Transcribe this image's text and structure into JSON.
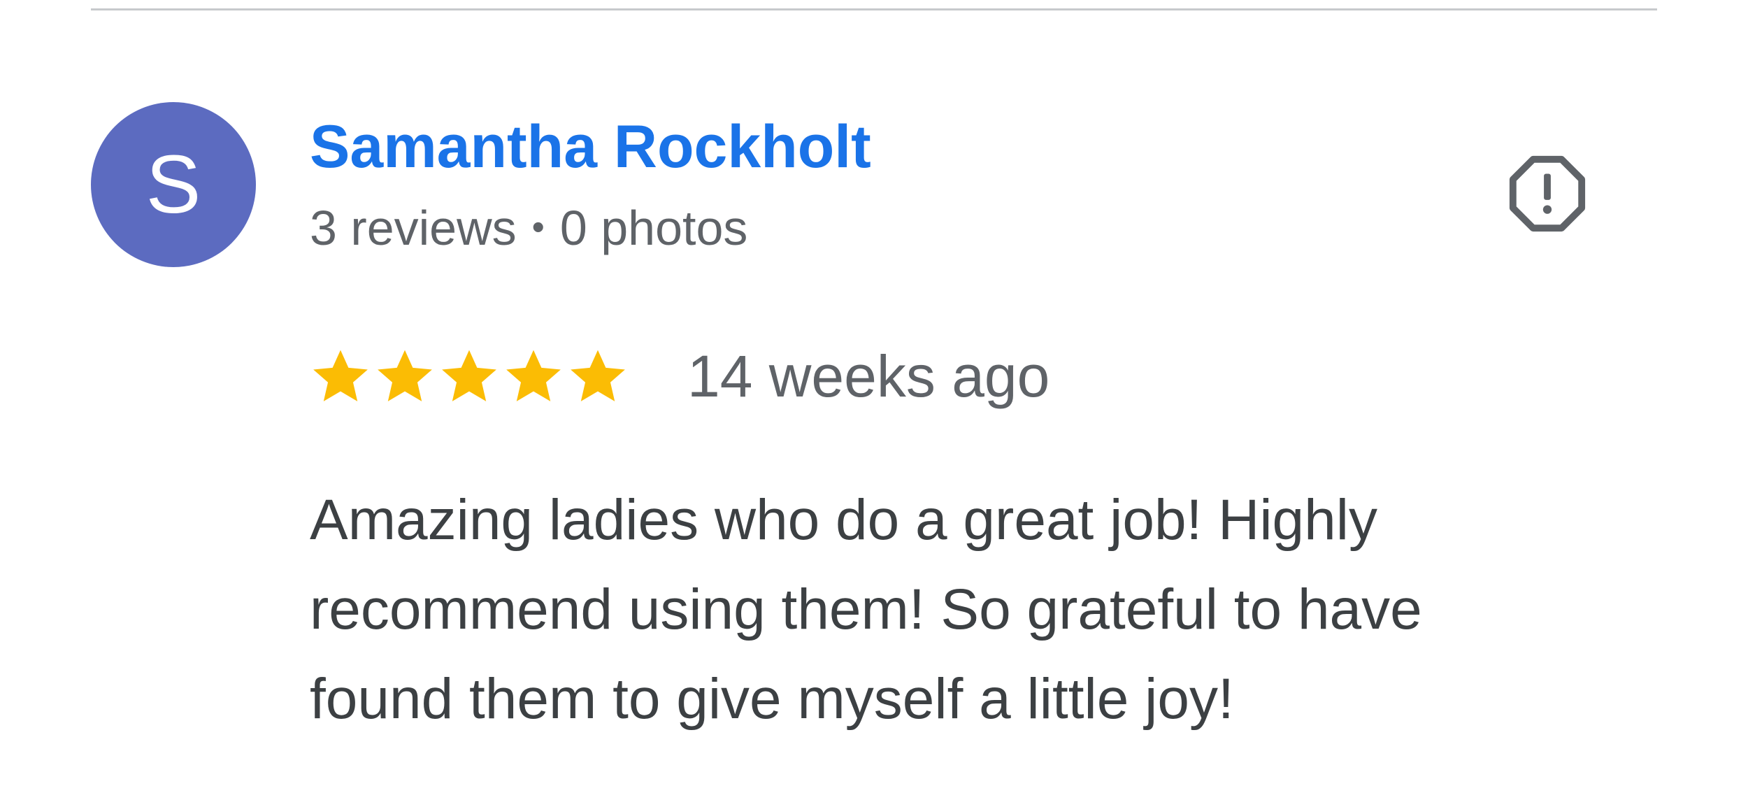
{
  "reviewer": {
    "avatar_letter": "S",
    "name": "Samantha Rockholt",
    "reviews_count": "3 reviews",
    "separator": "•",
    "photos_count": "0 photos"
  },
  "review": {
    "rating": 5,
    "rating_max": 5,
    "time_ago": "14 weeks ago",
    "lines": [
      "Amazing ladies who do a great job! Highly",
      "recommend using them! So grateful to have",
      "found them to give myself a little joy!"
    ]
  },
  "icons": {
    "report": "report-flag-octagon-icon",
    "star": "star-icon"
  },
  "colors": {
    "avatar_bg": "#5c6bc0",
    "name": "#1a73e8",
    "star": "#fbbc04",
    "meta_text": "#5f6368",
    "body_text": "#3c4043",
    "report_icon": "#5f6368"
  }
}
